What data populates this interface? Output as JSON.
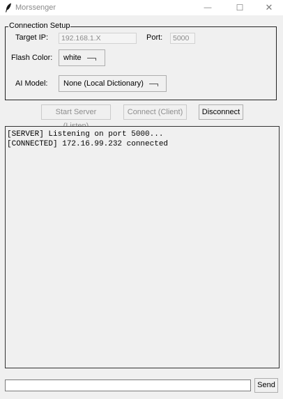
{
  "window": {
    "title": "Morssenger",
    "controls": {
      "minimize": "—",
      "maximize": "☐",
      "close": "✕"
    }
  },
  "connection_setup": {
    "title": "Connection Setup",
    "target_ip_label": "Target IP:",
    "target_ip_value": "192.168.1.X",
    "port_label": "Port:",
    "port_value": "5000",
    "flash_color_label": "Flash Color:",
    "flash_color_value": "white",
    "ai_model_label": "AI Model:",
    "ai_model_value": "None (Local Dictionary)"
  },
  "actions": {
    "start_server": "Start Server (Listen)",
    "connect": "Connect (Client)",
    "disconnect": "Disconnect"
  },
  "log": {
    "lines": [
      "[SERVER] Listening on port 5000...",
      "[CONNECTED] 172.16.99.232 connected"
    ]
  },
  "composer": {
    "message_value": "",
    "send_label": "Send"
  }
}
